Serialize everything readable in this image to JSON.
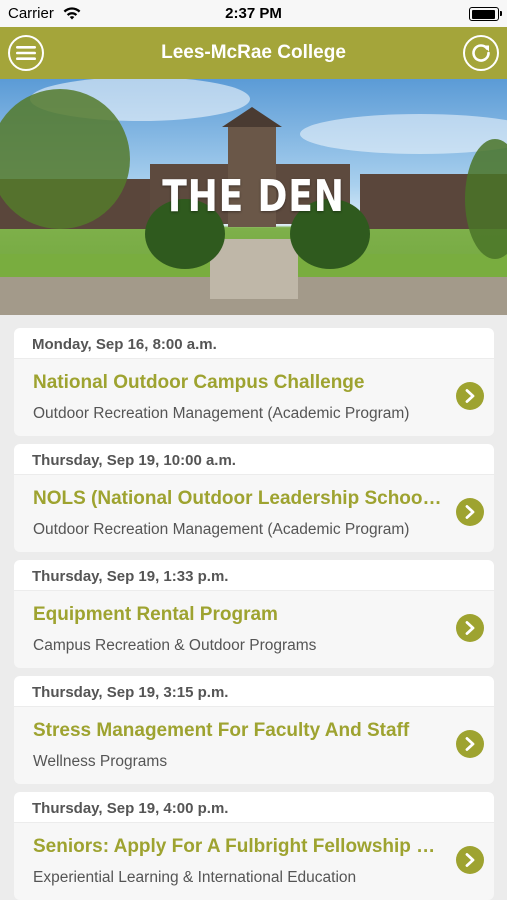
{
  "status_bar": {
    "carrier": "Carrier",
    "time": "2:37 PM"
  },
  "nav": {
    "title": "Lees-McRae College",
    "menu_icon": "menu-icon",
    "refresh_icon": "refresh-icon",
    "color": "#a4a53a"
  },
  "hero": {
    "title": "THE DEN"
  },
  "events": [
    {
      "date": "Monday, Sep 16, 8:00 a.m.",
      "title": "National Outdoor Campus Challenge",
      "department": "Outdoor Recreation Management (Academic Program)"
    },
    {
      "date": "Thursday, Sep 19, 10:00 a.m.",
      "title": "NOLS (National Outdoor Leadership School) Info Session",
      "department": "Outdoor Recreation Management (Academic Program)"
    },
    {
      "date": "Thursday, Sep 19, 1:33 p.m.",
      "title": "Equipment Rental Program",
      "department": "Campus Recreation & Outdoor Programs"
    },
    {
      "date": "Thursday, Sep 19, 3:15 p.m.",
      "title": "Stress Management For Faculty And Staff",
      "department": "Wellness Programs"
    },
    {
      "date": "Thursday, Sep 19, 4:00 p.m.",
      "title": "Seniors: Apply For A Fulbright Fellowship Today",
      "department": "Experiential Learning & International Education"
    }
  ],
  "accent_color": "#9ea330"
}
